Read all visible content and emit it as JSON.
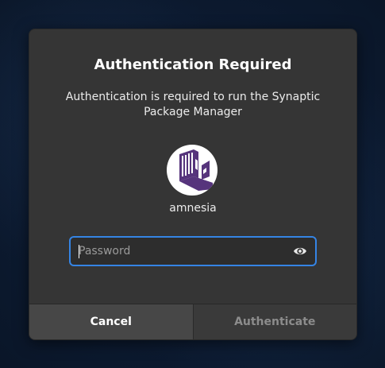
{
  "dialog": {
    "title": "Authentication Required",
    "message": "Authentication is required to run the Synaptic Package Manager",
    "username": "amnesia",
    "avatar_icon": "tails-logo-icon",
    "password": {
      "placeholder": "Password",
      "value": "",
      "reveal_icon": "eye-icon"
    },
    "buttons": {
      "cancel_label": "Cancel",
      "authenticate_label": "Authenticate"
    }
  },
  "colors": {
    "dialog_bg": "#353535",
    "focus_ring": "#3584e4",
    "avatar_logo": "#56347c"
  }
}
